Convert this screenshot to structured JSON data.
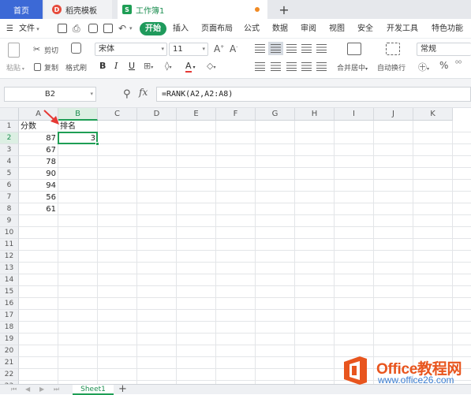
{
  "tabs": {
    "home": "首页",
    "template": "稻壳模板",
    "workbook": "工作簿1",
    "new_tab": "+"
  },
  "menu": {
    "file": "文件",
    "start": "开始",
    "items": [
      "插入",
      "页面布局",
      "公式",
      "数据",
      "审阅",
      "视图",
      "安全",
      "开发工具",
      "特色功能"
    ]
  },
  "ribbon": {
    "paste": "粘贴",
    "cut": "剪切",
    "copy": "复制",
    "format_painter": "格式刷",
    "font_name": "宋体",
    "font_size": "11",
    "bold": "B",
    "italic": "I",
    "underline": "U",
    "font_color": "A",
    "merge_center": "合并居中",
    "wrap_text": "自动换行",
    "number_format": "常规",
    "percent": "%"
  },
  "formula_bar": {
    "cell_ref": "B2",
    "fx": "fx",
    "formula": "=RANK(A2,A2:A8)"
  },
  "sheet": {
    "columns": [
      "A",
      "B",
      "C",
      "D",
      "E",
      "F",
      "G",
      "H",
      "I",
      "J",
      "K"
    ],
    "active_column": "B",
    "rows": [
      "1",
      "2",
      "3",
      "4",
      "5",
      "6",
      "7",
      "8",
      "9",
      "10",
      "11",
      "12",
      "13",
      "14",
      "15",
      "16",
      "17",
      "18",
      "19",
      "20",
      "21",
      "22",
      "23"
    ],
    "active_row": "2",
    "cells": {
      "A1": "分数",
      "B1": "排名",
      "A2": "87",
      "B2": "3",
      "A3": "67",
      "A4": "78",
      "A5": "90",
      "A6": "94",
      "A7": "56",
      "A8": "61"
    },
    "selected_cell": "B2",
    "sheet_tab": "Sheet1",
    "add_sheet": "+"
  },
  "watermark": {
    "brand": "Office教程网",
    "url": "www.office26.com"
  },
  "colors": {
    "accent_green": "#1e9e55",
    "home_tab_blue": "#3c69d6",
    "annotation_red": "#e53935"
  }
}
